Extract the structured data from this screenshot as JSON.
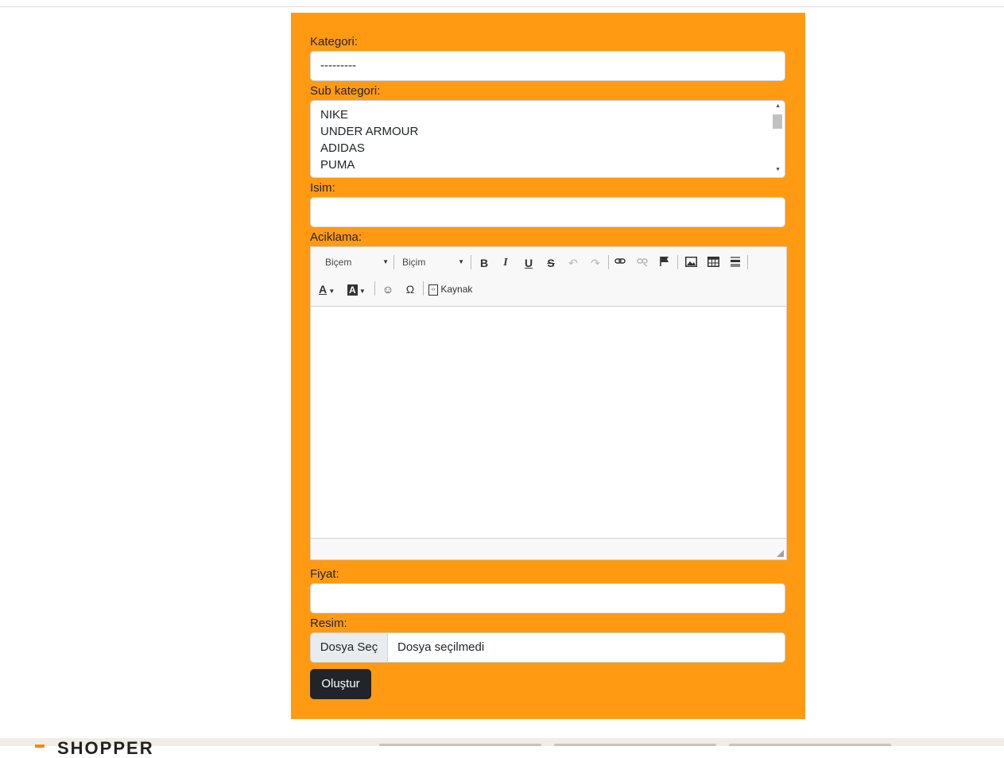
{
  "form": {
    "category_label": "Kategori:",
    "category_value": "---------",
    "subcategory_label": "Sub kategori:",
    "subcategory_options": [
      "NIKE",
      "UNDER ARMOUR",
      "ADIDAS",
      "PUMA"
    ],
    "name_label": "Isim:",
    "name_value": "",
    "description_label": "Aciklama:",
    "price_label": "Fiyat:",
    "price_value": "",
    "image_label": "Resim:",
    "file_button": "Dosya Seç",
    "file_status": "Dosya seçilmedi",
    "submit_label": "Oluştur"
  },
  "editor": {
    "style_combo": "Biçem",
    "format_combo": "Biçim",
    "source_label": "Kaynak",
    "icons": [
      "bold-icon",
      "italic-icon",
      "underline-icon",
      "strike-icon",
      "undo-icon",
      "redo-icon",
      "link-icon",
      "unlink-icon",
      "anchor-icon",
      "image-icon",
      "table-icon",
      "horizontal-line-icon",
      "text-color-icon",
      "background-color-icon",
      "smiley-icon",
      "special-char-icon",
      "source-icon"
    ]
  },
  "footer": {
    "logo_text": "SHOPPER"
  },
  "colors": {
    "panel": "#ff9a12",
    "button_dark": "#212529",
    "accent_logo": "#ff8a00"
  }
}
